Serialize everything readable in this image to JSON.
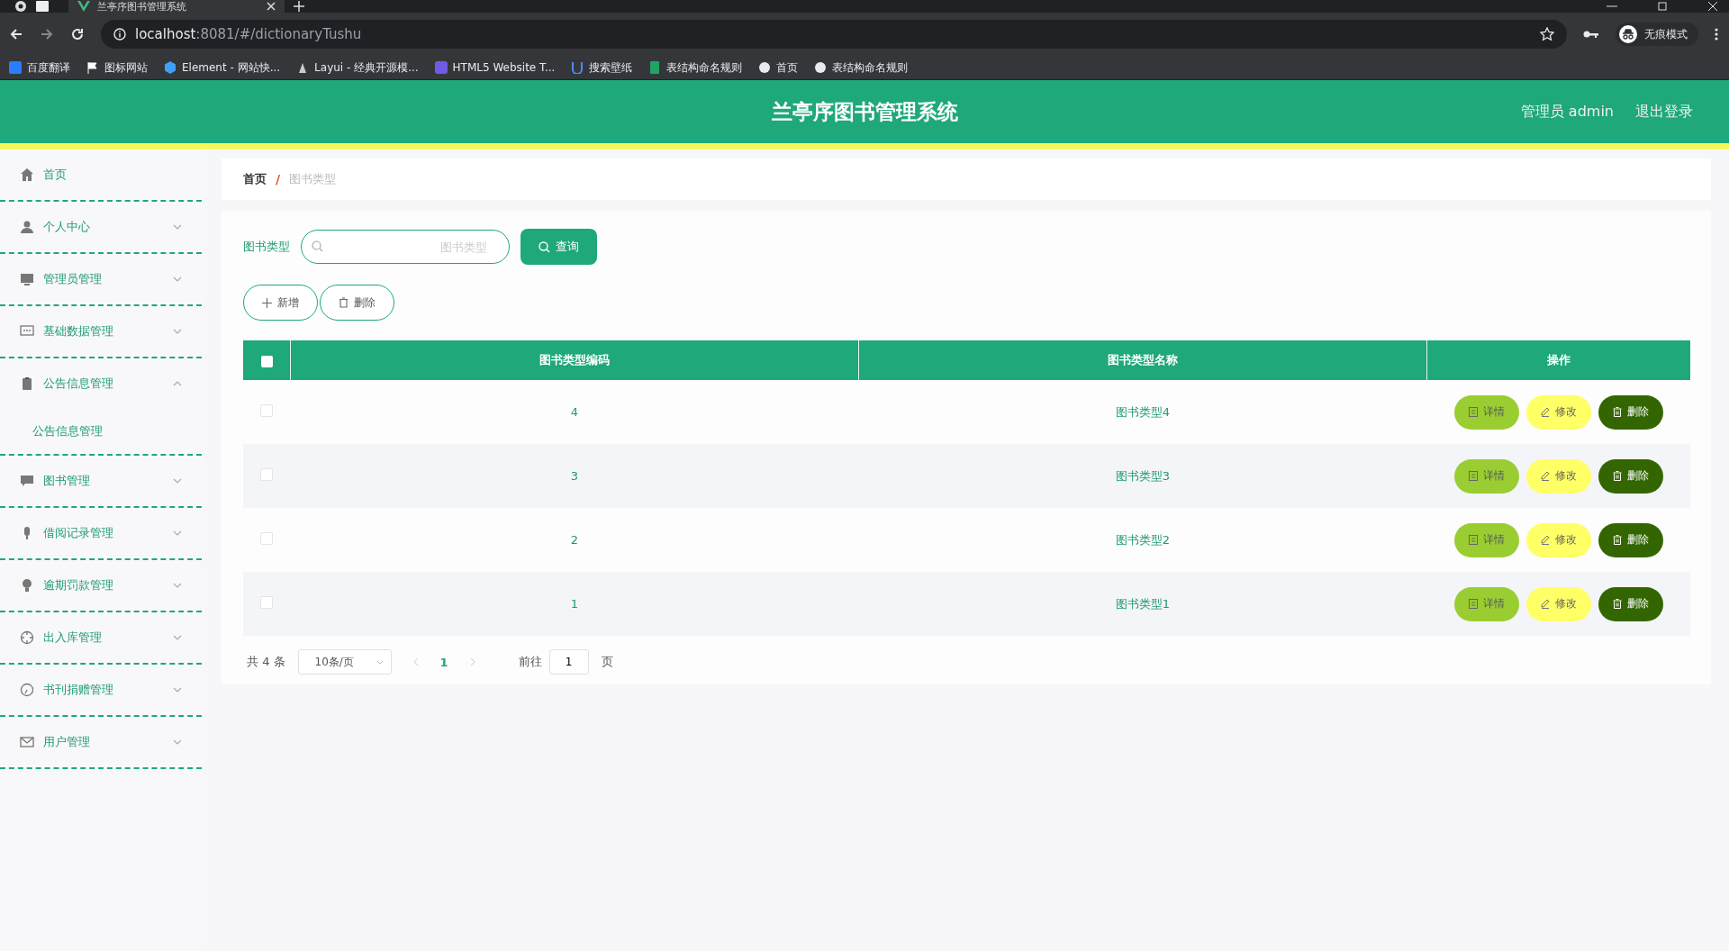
{
  "browser": {
    "tab_title": "兰亭序图书管理系统",
    "address_host": "localhost",
    "address_path": ":8081/#/dictionaryTushu",
    "profile_label": "无痕模式",
    "bookmarks": [
      "百度翻译",
      "图标网站",
      "Element - 网站快...",
      "Layui - 经典开源模...",
      "HTML5 Website T...",
      "搜索壁纸",
      "表结构命名规则",
      "首页",
      "表结构命名规则"
    ]
  },
  "header": {
    "title": "兰亭序图书管理系统",
    "user": "管理员 admin",
    "logout": "退出登录"
  },
  "sidebar": {
    "items": [
      {
        "label": "首页",
        "kind": "link"
      },
      {
        "label": "个人中心",
        "kind": "menu",
        "expanded": false
      },
      {
        "label": "管理员管理",
        "kind": "menu",
        "expanded": false
      },
      {
        "label": "基础数据管理",
        "kind": "menu",
        "expanded": false
      },
      {
        "label": "公告信息管理",
        "kind": "menu",
        "expanded": true,
        "children": [
          {
            "label": "公告信息管理"
          }
        ]
      },
      {
        "label": "图书管理",
        "kind": "menu",
        "expanded": false
      },
      {
        "label": "借阅记录管理",
        "kind": "menu",
        "expanded": false
      },
      {
        "label": "逾期罚款管理",
        "kind": "menu",
        "expanded": false
      },
      {
        "label": "出入库管理",
        "kind": "menu",
        "expanded": false
      },
      {
        "label": "书刊捐赠管理",
        "kind": "menu",
        "expanded": false
      },
      {
        "label": "用户管理",
        "kind": "menu",
        "expanded": false
      }
    ]
  },
  "breadcrumb": {
    "separator": "/",
    "items": [
      "首页",
      "图书类型"
    ]
  },
  "search": {
    "label": "图书类型",
    "placeholder": "图书类型",
    "button": "查询"
  },
  "toolbar": [
    "新增",
    "删除"
  ],
  "table": {
    "select_all_checked": false,
    "columns": [
      "图书类型编码",
      "图书类型名称",
      "操作"
    ],
    "rows": [
      {
        "checked": false,
        "code": "4",
        "name": "图书类型4",
        "actions": [
          {
            "kind": "detail",
            "label": "详情"
          },
          {
            "kind": "edit",
            "label": "修改"
          },
          {
            "kind": "delete",
            "label": "删除"
          }
        ]
      },
      {
        "checked": false,
        "code": "3",
        "name": "图书类型3",
        "actions": [
          {
            "kind": "detail",
            "label": "详情"
          },
          {
            "kind": "edit",
            "label": "修改"
          },
          {
            "kind": "delete",
            "label": "删除"
          }
        ]
      },
      {
        "checked": false,
        "code": "2",
        "name": "图书类型2",
        "actions": [
          {
            "kind": "detail",
            "label": "详情"
          },
          {
            "kind": "edit",
            "label": "修改"
          },
          {
            "kind": "delete",
            "label": "删除"
          }
        ]
      },
      {
        "checked": false,
        "code": "1",
        "name": "图书类型1",
        "actions": [
          {
            "kind": "detail",
            "label": "详情"
          },
          {
            "kind": "edit",
            "label": "修改"
          },
          {
            "kind": "delete",
            "label": "删除"
          }
        ]
      }
    ]
  },
  "pagination": {
    "total": "共 4 条",
    "page_size": "10条/页",
    "pages": [
      {
        "label": "1",
        "selected": true
      }
    ],
    "goto_label": "前往",
    "goto_value": "1",
    "goto_suffix": "页"
  }
}
